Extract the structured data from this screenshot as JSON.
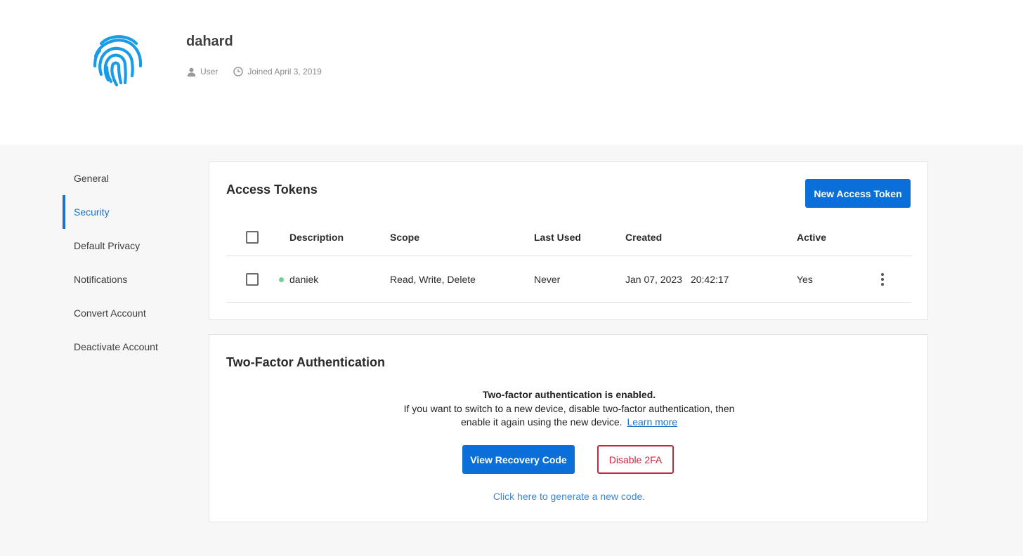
{
  "profile": {
    "username": "dahard",
    "role": "User",
    "joined": "Joined April 3, 2019",
    "avatar_icon": "fingerprint-icon",
    "avatar_color": "#1a9be6"
  },
  "sidebar": {
    "items": [
      {
        "label": "General",
        "active": false
      },
      {
        "label": "Security",
        "active": true
      },
      {
        "label": "Default Privacy",
        "active": false
      },
      {
        "label": "Notifications",
        "active": false
      },
      {
        "label": "Convert Account",
        "active": false
      },
      {
        "label": "Deactivate Account",
        "active": false
      }
    ]
  },
  "tokens": {
    "title": "Access Tokens",
    "new_button": "New Access Token",
    "columns": [
      "Description",
      "Scope",
      "Last Used",
      "Created",
      "Active"
    ],
    "rows": [
      {
        "description": "daniek",
        "scope": "Read, Write, Delete",
        "last_used": "Never",
        "created_date": "Jan 07, 2023",
        "created_time": "20:42:17",
        "active": "Yes",
        "status_color": "#6fcf97"
      }
    ]
  },
  "tfa": {
    "title": "Two-Factor Authentication",
    "status": "Two-factor authentication is enabled.",
    "line1": "If you want to switch to a new device, disable two-factor authentication, then",
    "line2": "enable it again using the new device.",
    "learn_more": "Learn more",
    "recovery_button": "View Recovery Code",
    "disable_button": "Disable 2FA",
    "generate_link": "Click here to generate a new code."
  },
  "colors": {
    "accent": "#0a6fd8",
    "danger": "#c8263e",
    "link": "#3b86d6"
  }
}
